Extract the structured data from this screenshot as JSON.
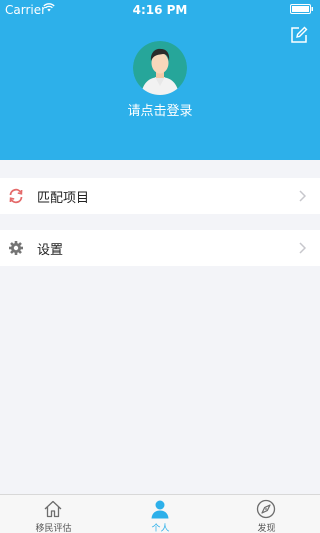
{
  "status_bar": {
    "carrier": "Carrier",
    "time": "4:16 PM"
  },
  "header": {
    "login_prompt": "请点击登录",
    "background_color": "#2db0ea"
  },
  "menu": [
    {
      "label": "匹配项目",
      "icon": "sync-icon"
    },
    {
      "label": "设置",
      "icon": "gear-icon"
    }
  ],
  "tabbar": {
    "active_color": "#2db0ea",
    "tabs": [
      {
        "label": "移民评估",
        "icon": "home-icon",
        "active": false
      },
      {
        "label": "个人",
        "icon": "person-icon",
        "active": true
      },
      {
        "label": "发现",
        "icon": "compass-icon",
        "active": false
      }
    ]
  }
}
